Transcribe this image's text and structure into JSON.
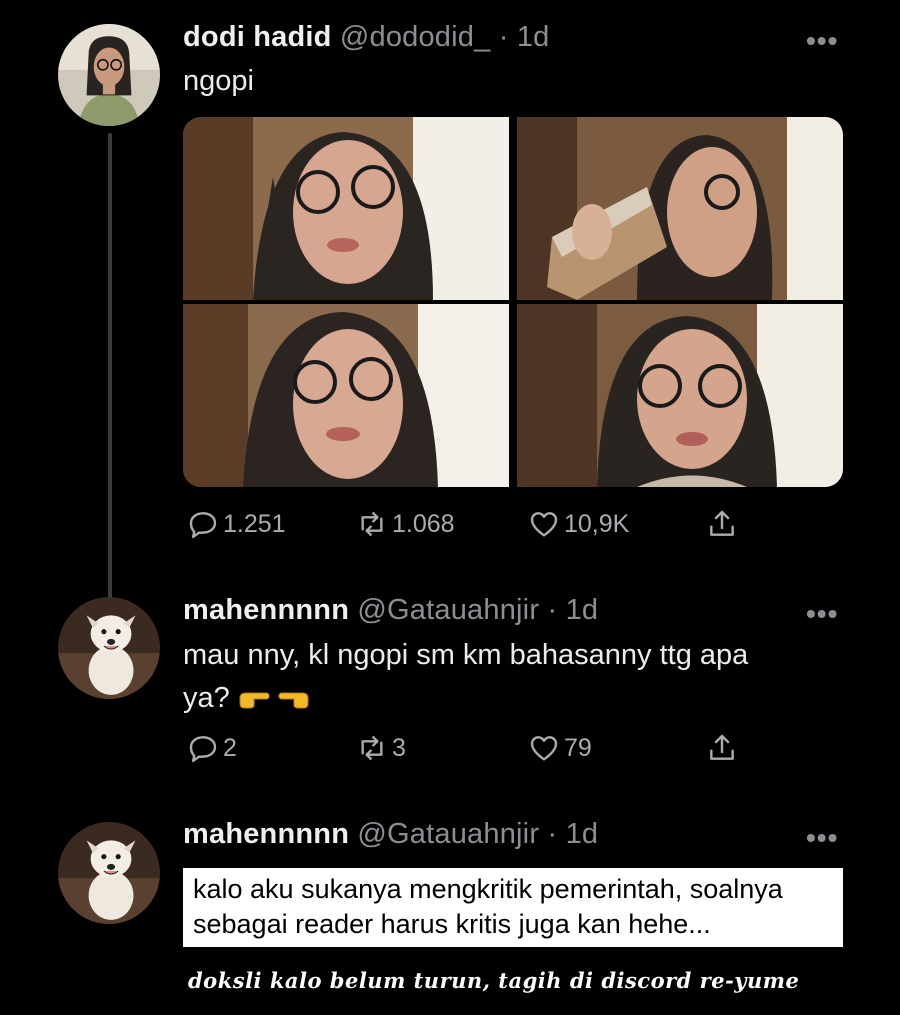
{
  "tweet": {
    "name": "dodi hadid",
    "handle": "@dododid_",
    "time": "· 1d",
    "text": "ngopi",
    "replies": "1.251",
    "retweets": "1.068",
    "likes": "10,9K",
    "photos": [
      "photo-1",
      "photo-2",
      "photo-3",
      "photo-4"
    ]
  },
  "reply1": {
    "name": "mahennnnn",
    "handle": "@Gatauahnjir",
    "time": "· 1d",
    "text_line1": "mau nny, kl ngopi sm km bahasanny ttg apa",
    "text_line2": "ya?",
    "replies": "2",
    "retweets": "3",
    "likes": "79"
  },
  "reply2": {
    "name": "mahennnnn",
    "handle": "@Gatauahnjir",
    "time": "· 1d",
    "overlay_line1": "kalo aku sukanya mengkritik pemerintah, soalnya",
    "overlay_line2": "sebagai reader harus kritis juga kan hehe..."
  },
  "more_label": "•••",
  "watermark": "doksli kalo belum turun, tagih di discord re-yume",
  "colors": {
    "background": "#000000",
    "text": "#e7e9ea",
    "muted": "#8b8f94"
  }
}
